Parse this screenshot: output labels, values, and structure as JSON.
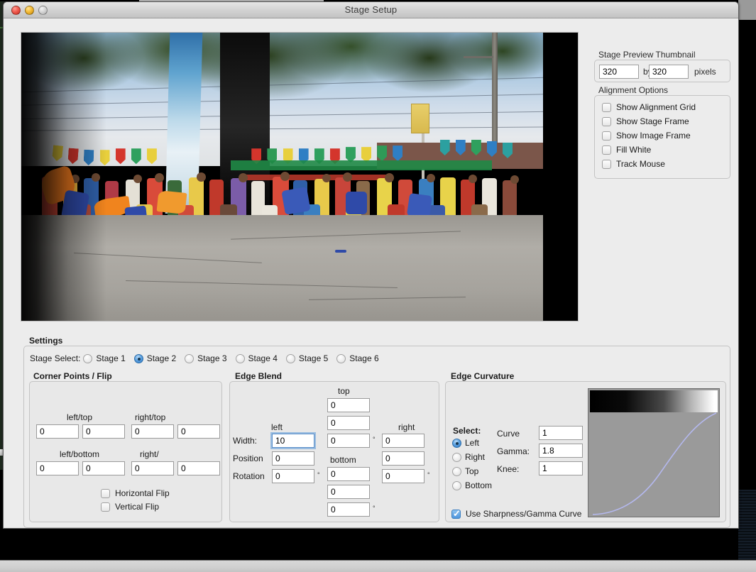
{
  "window": {
    "title": "Stage Setup",
    "traffic_lights": [
      "close-button",
      "minimize-button",
      "zoom-button"
    ]
  },
  "preview": {
    "name": "stage-preview-image",
    "description": "street festival photo with dancers and crowd"
  },
  "thumbnail": {
    "group_label": "Stage Preview Thumbnail",
    "width": "320",
    "by_label": "by",
    "height": "320",
    "units_label": "pixels"
  },
  "alignment": {
    "group_label": "Alignment Options",
    "options": [
      {
        "label": "Show Alignment Grid",
        "checked": false
      },
      {
        "label": "Show Stage Frame",
        "checked": false
      },
      {
        "label": "Show Image Frame",
        "checked": false
      },
      {
        "label": "Fill White",
        "checked": false
      },
      {
        "label": "Track Mouse",
        "checked": false
      }
    ]
  },
  "settings": {
    "label": "Settings",
    "stage_select_label": "Stage Select:",
    "stages": [
      {
        "label": "Stage 1",
        "selected": false
      },
      {
        "label": "Stage 2",
        "selected": true
      },
      {
        "label": "Stage 3",
        "selected": false
      },
      {
        "label": "Stage 4",
        "selected": false
      },
      {
        "label": "Stage 5",
        "selected": false
      },
      {
        "label": "Stage 6",
        "selected": false
      }
    ]
  },
  "corner_points": {
    "label": "Corner Points / Flip",
    "left_top_label": "left/top",
    "right_top_label": "right/top",
    "left_bottom_label": "left/bottom",
    "right_bottom_label": "right/",
    "left_top_x": "0",
    "left_top_y": "0",
    "right_top_x": "0",
    "right_top_y": "0",
    "left_bottom_x": "0",
    "left_bottom_y": "0",
    "right_bottom_x": "0",
    "right_bottom_y": "0",
    "horizontal_flip_label": "Horizontal Flip",
    "horizontal_flip_checked": false,
    "vertical_flip_label": "Vertical Flip",
    "vertical_flip_checked": false
  },
  "edge_blend": {
    "label": "Edge Blend",
    "top_label": "top",
    "bottom_label": "bottom",
    "left_label": "left",
    "right_label": "right",
    "width_label": "Width:",
    "position_label": "Position",
    "rotation_label": "Rotation",
    "degree_symbol": "°",
    "left_width": "10",
    "left_position": "0",
    "left_rotation": "0",
    "top_width": "0",
    "top_position": "0",
    "top_rotation": "0",
    "right_width": "0",
    "right_position": "0",
    "right_rotation": "0",
    "bottom_width": "0",
    "bottom_position": "0",
    "bottom_rotation": "0"
  },
  "edge_curvature": {
    "label": "Edge Curvature",
    "select_label": "Select:",
    "edges": [
      {
        "label": "Left",
        "selected": true
      },
      {
        "label": "Right",
        "selected": false
      },
      {
        "label": "Top",
        "selected": false
      },
      {
        "label": "Bottom",
        "selected": false
      }
    ],
    "curve_label": "Curve",
    "curve_value": "1",
    "gamma_label": "Gamma:",
    "gamma_value": "1.8",
    "knee_label": "Knee:",
    "knee_value": "1",
    "use_curve_label": "Use Sharpness/Gamma Curve",
    "use_curve_checked": true,
    "graph": {
      "curve_color": "#b4b8ee",
      "background": "#9a9a9a",
      "gradient_bar": "black-to-white"
    }
  }
}
